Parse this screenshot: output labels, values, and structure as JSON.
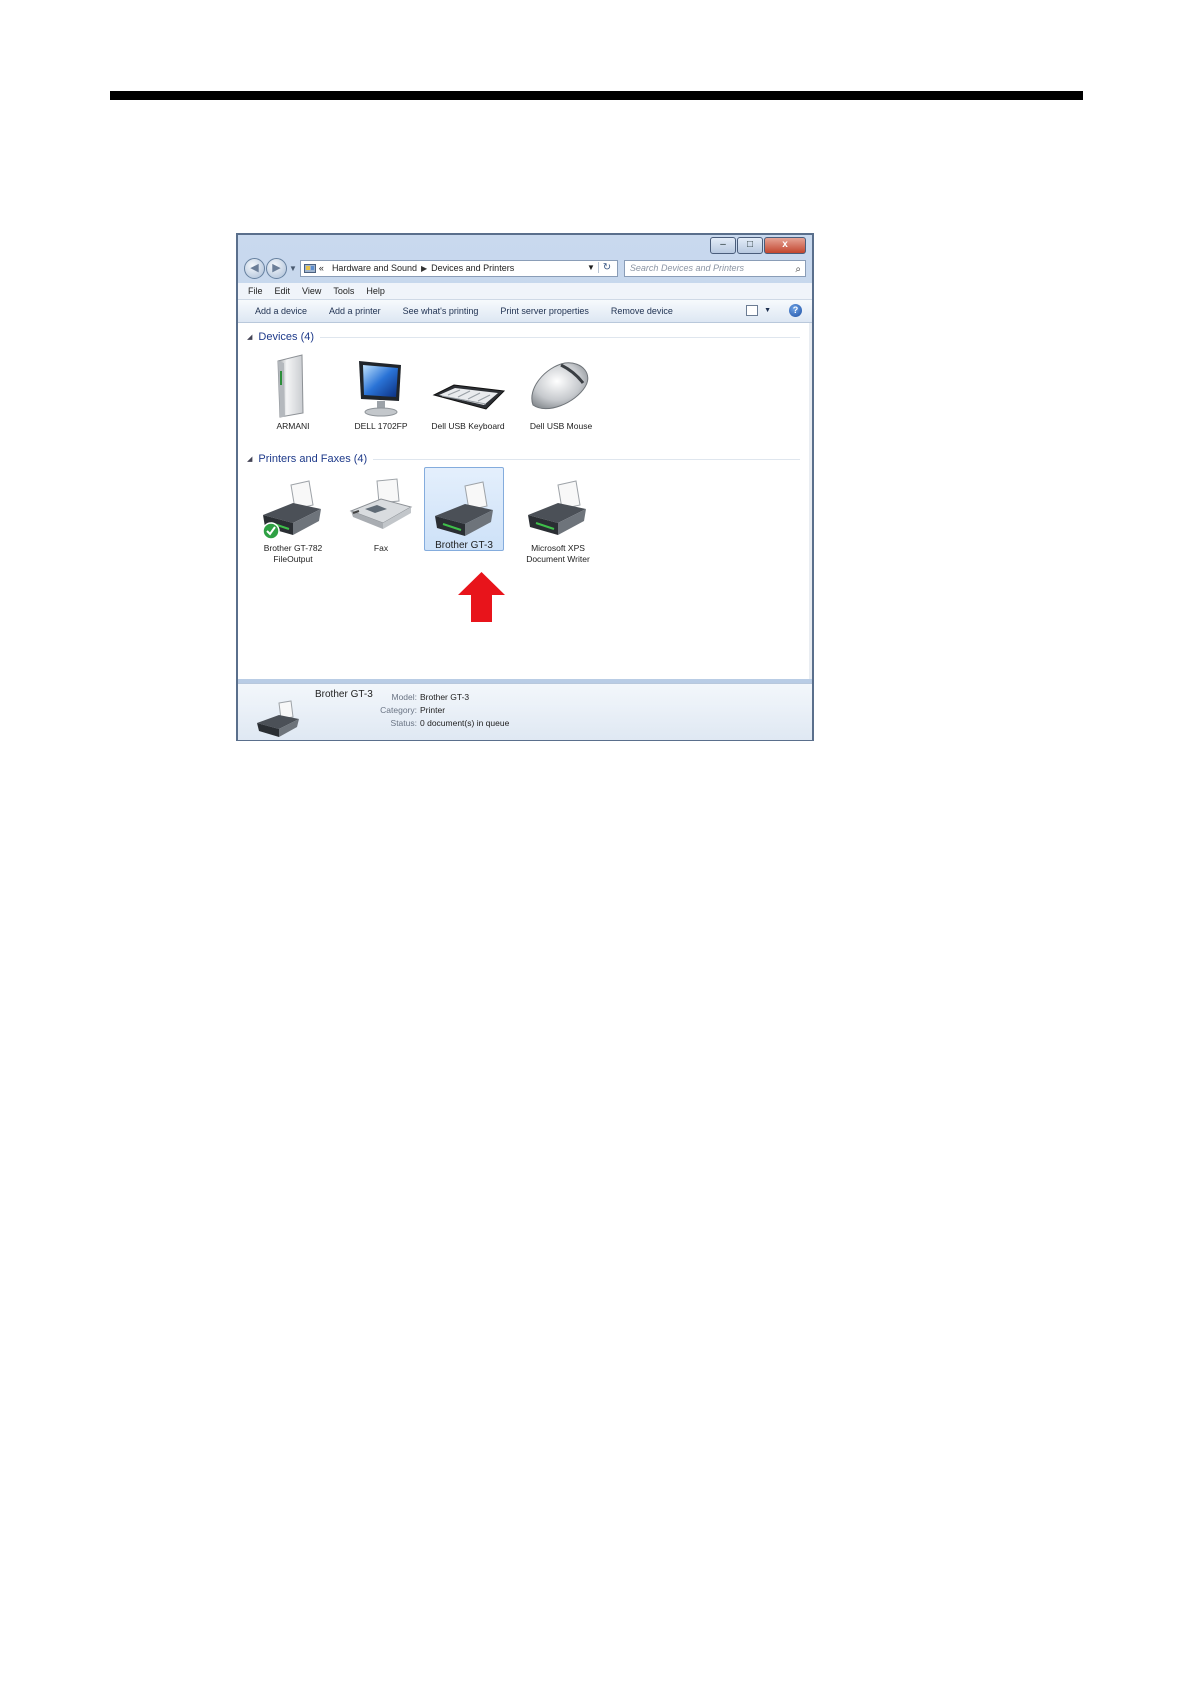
{
  "breadcrumb": {
    "overflow": "«",
    "items": [
      "Hardware and Sound",
      "Devices and Printers"
    ]
  },
  "search": {
    "placeholder": "Search Devices and Printers"
  },
  "menu": [
    "File",
    "Edit",
    "View",
    "Tools",
    "Help"
  ],
  "commands": [
    "Add a device",
    "Add a printer",
    "See what's printing",
    "Print server properties",
    "Remove device"
  ],
  "caption_buttons": {
    "minimize": "–",
    "maximize": "□",
    "close": "x"
  },
  "groups": {
    "devices": {
      "title": "Devices (4)",
      "items": [
        {
          "label": "ARMANI",
          "icon": "computer-tower-icon"
        },
        {
          "label": "DELL 1702FP",
          "icon": "monitor-icon"
        },
        {
          "label": "Dell USB Keyboard",
          "icon": "keyboard-icon"
        },
        {
          "label": "Dell USB Mouse",
          "icon": "mouse-icon"
        }
      ]
    },
    "printers": {
      "title": "Printers and Faxes (4)",
      "items": [
        {
          "label": "Brother GT-782 FileOutput",
          "icon": "printer-icon",
          "default": true
        },
        {
          "label": "Fax",
          "icon": "fax-icon"
        },
        {
          "label": "Brother GT-3",
          "icon": "printer-icon",
          "selected": true
        },
        {
          "label": "Microsoft XPS Document Writer",
          "icon": "printer-icon"
        }
      ]
    }
  },
  "details": {
    "name": "Brother GT-3",
    "rows": [
      {
        "key": "Model:",
        "value": "Brother GT-3"
      },
      {
        "key": "Category:",
        "value": "Printer"
      },
      {
        "key": "Status:",
        "value": "0 document(s) in queue"
      }
    ]
  },
  "colors": {
    "selection": "#cde1f8",
    "arrow": "#e8141b",
    "group_header": "#1e3a8a"
  }
}
